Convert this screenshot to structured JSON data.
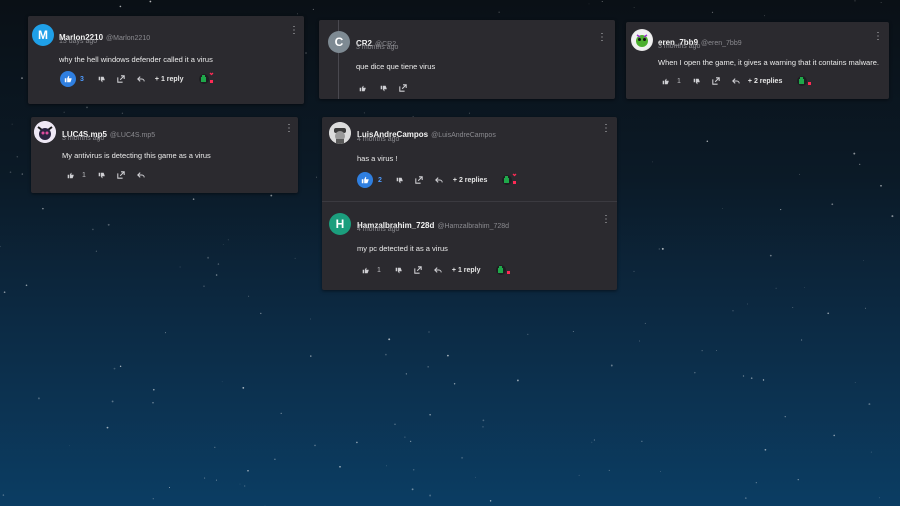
{
  "comments": {
    "c1": {
      "username": "Marlon2210",
      "handle": "@Marlon2210",
      "date": "13 days ago",
      "text": "why the hell windows defender called it a virus",
      "likes": "3",
      "replies": "+ 1 reply",
      "avatar_letter": "M"
    },
    "c2": {
      "username": "CR2",
      "handle": "@CR2",
      "date": "3 months ago",
      "text": "que dice que tiene virus",
      "avatar_letter": "C"
    },
    "c3": {
      "username": "eren_7bb9",
      "handle": "@eren_7bb9",
      "date": "3 months ago",
      "text": "When I open the game, it gives a warning that it contains malware.",
      "likes": "1",
      "replies": "+ 2 replies"
    },
    "c4": {
      "username": "LUC4S.mp5",
      "handle": "@LUC4S.mp5",
      "date": "3 months ago",
      "text": "My antivirus is detecting this game as a virus",
      "likes": "1"
    },
    "c5": {
      "username": "LuisAndreCampos",
      "handle": "@LuisAndreCampos",
      "date": "4 months ago",
      "text": "has a virus !",
      "likes": "2",
      "replies": "+ 2 replies"
    },
    "c6": {
      "username": "Hamzalbrahim_728d",
      "handle": "@Hamzalbrahim_728d",
      "date": "4 months ago",
      "text": "my pc detected it as a virus",
      "likes": "1",
      "replies": "+ 1 reply",
      "avatar_letter": "H"
    }
  },
  "colors": {
    "accent": "#2f7fe0",
    "card": "#2b2a2f",
    "bug_green": "#1fa84a",
    "bug_red": "#ff2a55"
  }
}
